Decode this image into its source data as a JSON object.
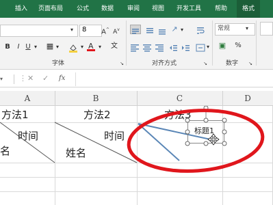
{
  "ribbon": {
    "tabs": [
      "插入",
      "页面布局",
      "公式",
      "数据",
      "审阅",
      "视图",
      "开发工具",
      "帮助",
      "格式"
    ],
    "font_size": "8",
    "font_group_label": "字体",
    "align_group_label": "对齐方式",
    "number_group_label": "数字",
    "number_format": "常规",
    "percent_symbol": "%"
  },
  "formula_bar": {
    "fx_label": "fx"
  },
  "columns": [
    "A",
    "B",
    "C",
    "D"
  ],
  "cells": {
    "a1": "方法1",
    "b1": "方法2",
    "c1": "方法3",
    "a_time": "时间",
    "a_name": "名",
    "b_time": "时间",
    "b_name": "姓名"
  },
  "textbox": {
    "text": "标题1"
  },
  "colors": {
    "ribbon_green": "#217346",
    "annotation_red": "#e0161c",
    "drawn_line": "#5a86b6"
  }
}
